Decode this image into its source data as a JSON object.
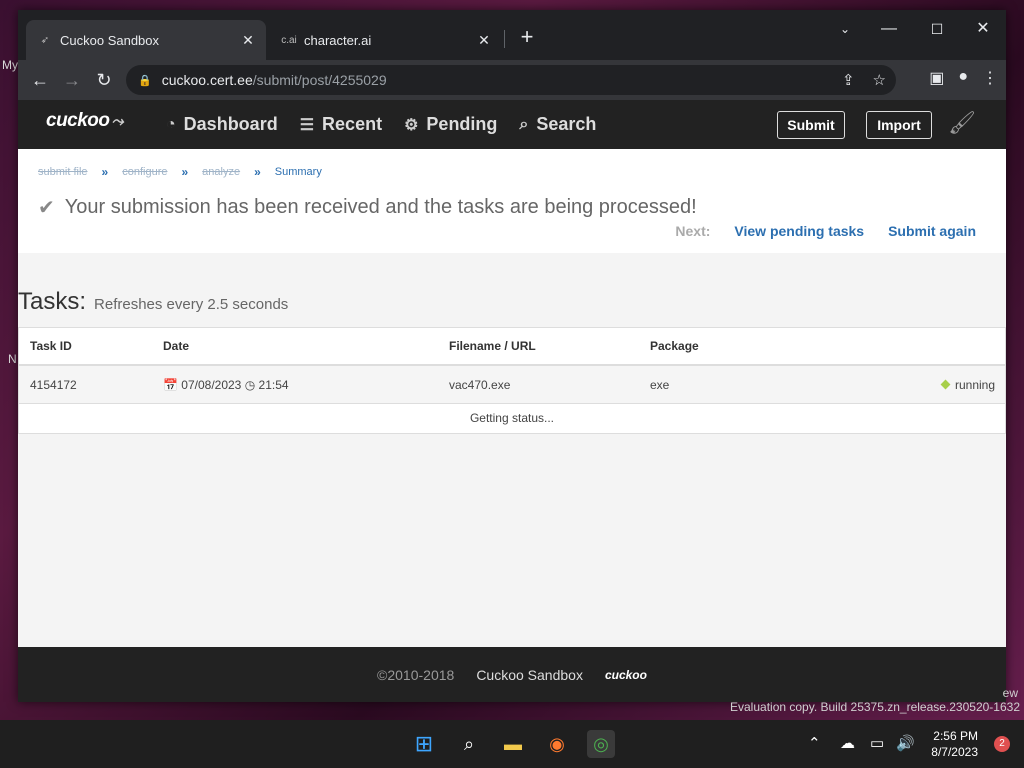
{
  "desktop": {
    "left_label_1": "My",
    "left_label_2": "N",
    "watermark": "Evaluation copy. Build 25375.zn_release.230520-1632",
    "watermark_top": "ew"
  },
  "browser": {
    "tabs": [
      {
        "favicon": "cuckoo-favicon",
        "title": "Cuckoo Sandbox",
        "active": true
      },
      {
        "favicon": "c.ai",
        "title": "character.ai",
        "active": false
      }
    ],
    "new_tab": "+",
    "url_host": "cuckoo.cert.ee",
    "url_path": "/submit/post/4255029"
  },
  "cuckoo": {
    "logo": "cuckoo",
    "nav": [
      {
        "icon": "dashboard-icon",
        "label": "Dashboard"
      },
      {
        "icon": "list-icon",
        "label": "Recent"
      },
      {
        "icon": "cogs-icon",
        "label": "Pending"
      },
      {
        "icon": "search-icon",
        "label": "Search"
      }
    ],
    "submit_button": "Submit",
    "import_button": "Import",
    "breadcrumbs": {
      "step1": "submit file",
      "step2": "configure",
      "step3": "analyze",
      "current": "Summary"
    },
    "success_message": "Your submission has been received and the tasks are being processed!",
    "next_label": "Next:",
    "view_pending": "View pending tasks",
    "submit_again": "Submit again",
    "tasks_title": "Tasks:",
    "tasks_subtitle": "Refreshes every 2.5 seconds",
    "table": {
      "headers": [
        "Task ID",
        "Date",
        "Filename / URL",
        "Package"
      ],
      "rows": [
        {
          "task_id": "4154172",
          "date": "07/08/2023",
          "time": "21:54",
          "filename": "vac470.exe",
          "package": "exe",
          "status": "running"
        }
      ],
      "status_text": "Getting status..."
    },
    "footer": {
      "copyright": "©2010-2018",
      "name": "Cuckoo Sandbox",
      "logo": "cuckoo"
    }
  },
  "taskbar": {
    "time": "2:56 PM",
    "date": "8/7/2023",
    "notifications": "2"
  },
  "colors": {
    "link": "#2c6fb0",
    "nav_bg": "#222222",
    "running": "#a7cf4a"
  }
}
